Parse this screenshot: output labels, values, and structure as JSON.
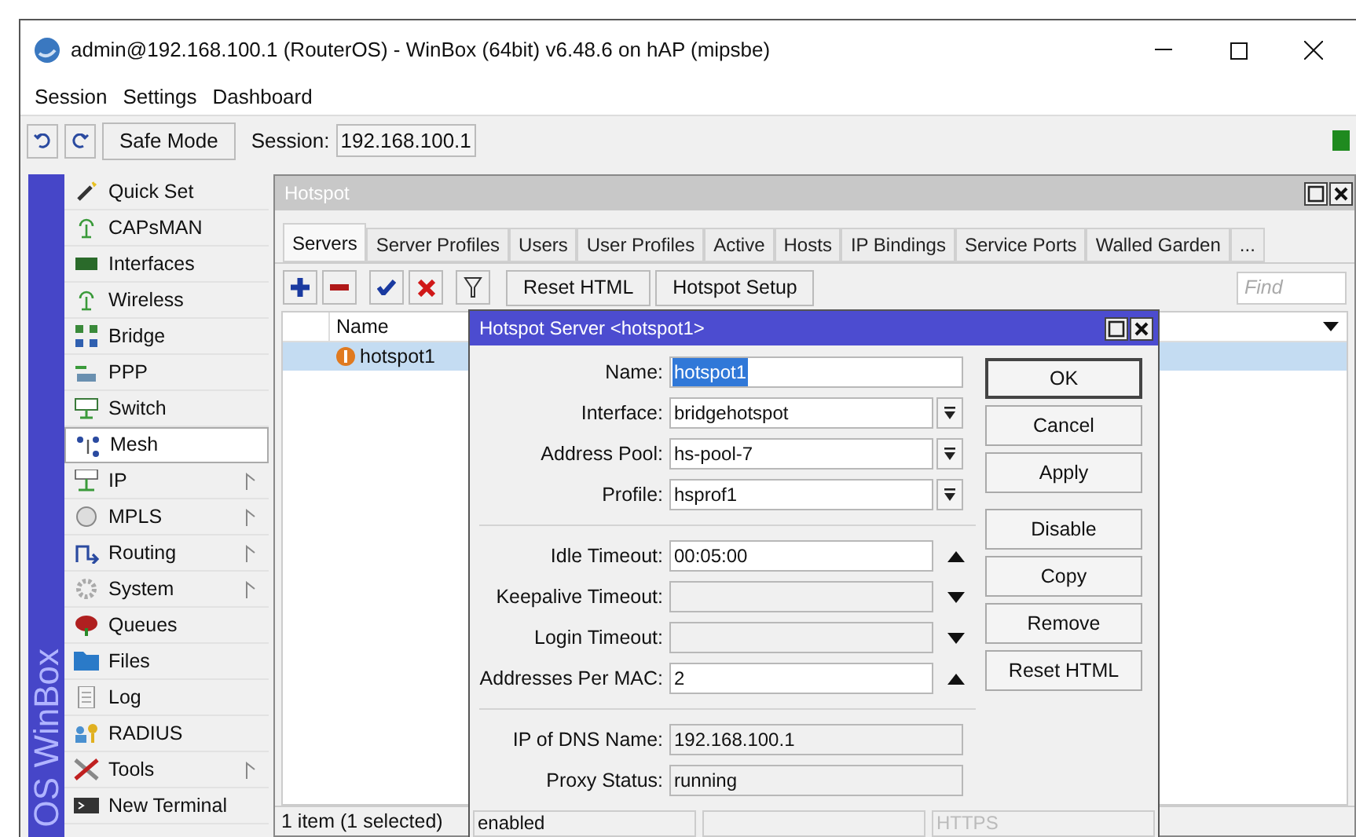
{
  "window": {
    "title": "admin@192.168.100.1 (RouterOS) - WinBox (64bit) v6.48.6 on hAP (mipsbe)"
  },
  "menu": [
    "Session",
    "Settings",
    "Dashboard"
  ],
  "toolbar": {
    "safe_mode": "Safe Mode",
    "session_label": "Session:",
    "session_value": "192.168.100.1"
  },
  "sidebar": {
    "brand": "OS WinBox",
    "items": [
      {
        "label": "Quick Set",
        "submenu": false,
        "selected": false
      },
      {
        "label": "CAPsMAN",
        "submenu": false,
        "selected": false
      },
      {
        "label": "Interfaces",
        "submenu": false,
        "selected": false
      },
      {
        "label": "Wireless",
        "submenu": false,
        "selected": false
      },
      {
        "label": "Bridge",
        "submenu": false,
        "selected": false
      },
      {
        "label": "PPP",
        "submenu": false,
        "selected": false
      },
      {
        "label": "Switch",
        "submenu": false,
        "selected": false
      },
      {
        "label": "Mesh",
        "submenu": false,
        "selected": true
      },
      {
        "label": "IP",
        "submenu": true,
        "selected": false
      },
      {
        "label": "MPLS",
        "submenu": true,
        "selected": false
      },
      {
        "label": "Routing",
        "submenu": true,
        "selected": false
      },
      {
        "label": "System",
        "submenu": true,
        "selected": false
      },
      {
        "label": "Queues",
        "submenu": false,
        "selected": false
      },
      {
        "label": "Files",
        "submenu": false,
        "selected": false
      },
      {
        "label": "Log",
        "submenu": false,
        "selected": false
      },
      {
        "label": "RADIUS",
        "submenu": false,
        "selected": false
      },
      {
        "label": "Tools",
        "submenu": true,
        "selected": false
      },
      {
        "label": "New Terminal",
        "submenu": false,
        "selected": false
      }
    ]
  },
  "hotspot": {
    "title": "Hotspot",
    "tabs": [
      {
        "label": "Servers",
        "selected": true
      },
      {
        "label": "Server Profiles",
        "selected": false
      },
      {
        "label": "Users",
        "selected": false
      },
      {
        "label": "User Profiles",
        "selected": false
      },
      {
        "label": "Active",
        "selected": false
      },
      {
        "label": "Hosts",
        "selected": false
      },
      {
        "label": "IP Bindings",
        "selected": false
      },
      {
        "label": "Service Ports",
        "selected": false
      },
      {
        "label": "Walled Garden",
        "selected": false
      },
      {
        "label": "...",
        "selected": false
      }
    ],
    "buttons": [
      "Reset HTML",
      "Hotspot Setup"
    ],
    "find": {
      "placeholder": "Find"
    },
    "table": {
      "columns": [
        "Name"
      ],
      "rows": [
        {
          "name": "hotspot1",
          "selected": true
        }
      ]
    },
    "status_bar": "1 item (1 selected)"
  },
  "dialog": {
    "title": "Hotspot Server <hotspot1>",
    "sections": [
      [
        {
          "label": "Name:",
          "value": "hotspot1",
          "kind": "text",
          "text_selected": true
        },
        {
          "label": "Interface:",
          "value": "bridgehotspot",
          "kind": "dropdown"
        },
        {
          "label": "Address Pool:",
          "value": "hs-pool-7",
          "kind": "dropdown"
        },
        {
          "label": "Profile:",
          "value": "hsprof1",
          "kind": "dropdown"
        }
      ],
      [
        {
          "label": "Idle Timeout:",
          "value": "00:05:00",
          "kind": "up"
        },
        {
          "label": "Keepalive Timeout:",
          "kind": "down"
        },
        {
          "label": "Login Timeout:",
          "kind": "down"
        },
        {
          "label": "Addresses Per MAC:",
          "value": "2",
          "kind": "up"
        }
      ],
      [
        {
          "label": "IP of DNS Name:",
          "value": "192.168.100.1",
          "kind": "readonly"
        },
        {
          "label": "Proxy Status:",
          "value": "running",
          "kind": "readonly"
        }
      ]
    ],
    "buttons": [
      {
        "label": "OK",
        "default": true
      },
      {
        "label": "Cancel",
        "default": false
      },
      {
        "label": "Apply",
        "default": false
      },
      {
        "label": "Disable",
        "default": false
      },
      {
        "label": "Copy",
        "default": false
      },
      {
        "label": "Remove",
        "default": false
      },
      {
        "label": "Reset HTML",
        "default": false
      }
    ],
    "status_bar": [
      {
        "kind": "text",
        "text": "enabled",
        "dimmed": false
      },
      {
        "kind": "blank"
      },
      {
        "kind": "text",
        "text": "HTTPS",
        "dimmed": true
      }
    ]
  }
}
